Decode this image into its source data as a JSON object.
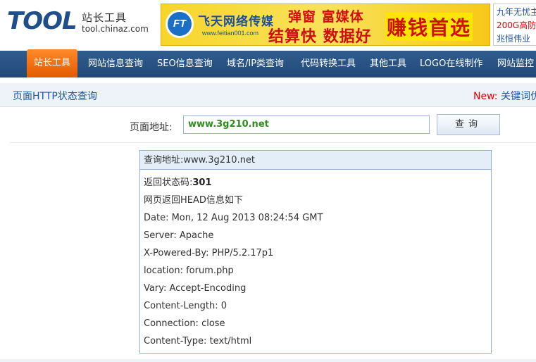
{
  "header": {
    "logo_text": "TOOL",
    "logo_cn": "站长工具",
    "logo_domain": "tool.chinaz.com",
    "banner": {
      "logo_letters": "FT",
      "company": "飞天网络传媒",
      "url": "www.feitian001.com",
      "slogan_1": "弹窗 富媒体",
      "slogan_2": "结算快 数据好",
      "big": "赚钱首选"
    },
    "side_ad": {
      "line_1": "九年无忧主",
      "line_2": "200G高防",
      "line_3": "兆恒伟业"
    }
  },
  "nav": {
    "items": [
      {
        "label": "站长工具"
      },
      {
        "label": "网站信息查询"
      },
      {
        "label": "SEO信息查询"
      },
      {
        "label": "域名/IP类查询"
      },
      {
        "label": "代码转换工具"
      },
      {
        "label": "其他工具"
      },
      {
        "label": "LOGO在线制作"
      },
      {
        "label": "网站监控"
      }
    ]
  },
  "subbar": {
    "title": "页面HTTP状态查询",
    "new_label": "New:",
    "new_link": " 关键词优"
  },
  "query": {
    "label": "页面地址:",
    "value": "www.3g210.net",
    "button": "查询"
  },
  "result": {
    "head_label": "查询地址:",
    "head_value": "www.3g210.net",
    "status_label": "返回状态码:",
    "status_code": "301",
    "lines": [
      "网页返回HEAD信息如下",
      "Date: Mon, 12 Aug 2013 08:24:54 GMT",
      "Server: Apache",
      "X-Powered-By: PHP/5.2.17p1",
      "location: forum.php",
      "Vary: Accept-Encoding",
      "Content-Length: 0",
      "Connection: close",
      "Content-Type: text/html"
    ]
  },
  "colors": {
    "nav_bg": "#2f5c8f",
    "nav_active": "#ff8a2a",
    "link_blue": "#1d55a2",
    "new_red": "#e00000",
    "input_text_green": "#2e8b1e"
  }
}
